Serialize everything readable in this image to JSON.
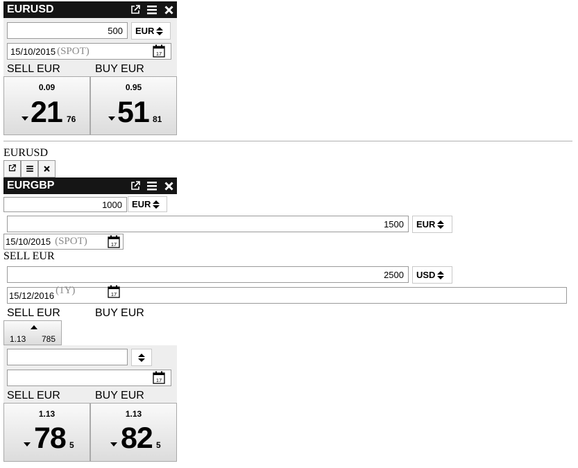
{
  "tile1": {
    "title": "EURUSD",
    "amount": "500",
    "currency": "EUR",
    "date": "15/10/2015",
    "tenor": "(SPOT)",
    "cal_day": "17",
    "sell_label": "SELL EUR",
    "buy_label": "BUY EUR",
    "sell": {
      "spread": "0.09",
      "big": "21",
      "pip": "76"
    },
    "buy": {
      "spread": "0.95",
      "big": "51",
      "pip": "81"
    }
  },
  "section2": {
    "title": "EURUSD"
  },
  "tile2": {
    "title": "EURGBP",
    "amount": "1000",
    "currency": "EUR",
    "amount2": "1500",
    "currency2": "EUR",
    "date": "15/10/2015",
    "tenor": "(SPOT)",
    "cal_day": "17",
    "sell_label_plain": "SELL EUR",
    "amount3": "2500",
    "currency3": "USD",
    "date2": "15/12/2016",
    "tenor2": "(1Y)",
    "cal_day2": "17",
    "sell_label": "SELL EUR",
    "buy_label": "BUY EUR",
    "small_tile": {
      "left": "1.13",
      "right": "785"
    }
  },
  "tile3": {
    "cal_day": "17",
    "sell_label": "SELL EUR",
    "buy_label": "BUY EUR",
    "sell": {
      "spread": "1.13",
      "big": "78",
      "pip": "5"
    },
    "buy": {
      "spread": "1.13",
      "big": "82",
      "pip": "5"
    }
  },
  "icons": {
    "popout": "popout-icon",
    "menu": "menu-icon",
    "close": "close-icon",
    "calendar": "calendar-icon"
  },
  "colors": {
    "titlebar": "#151515",
    "panel": "#eeeeee",
    "tenor": "#8a8a8a"
  }
}
